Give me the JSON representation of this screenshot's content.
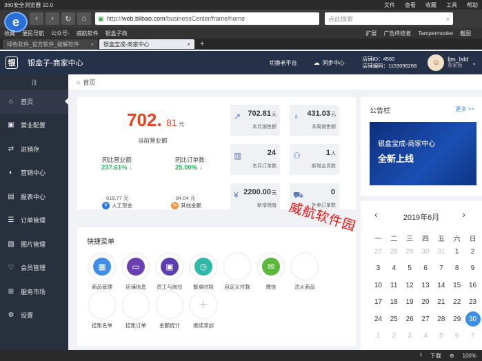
{
  "browser": {
    "title": "360安全浏览器 10.0",
    "menus": [
      "文件",
      "查看",
      "收藏",
      "工具",
      "帮助"
    ],
    "url_prefix": "http://",
    "url_domain": "web.blibao.com",
    "url_path": "/businessCenter/frame/home",
    "search_placeholder": "点此搜索",
    "bookmarks": [
      "收藏",
      "便民导航",
      "公众号-",
      "威航软件",
      "银盒子商"
    ],
    "bookmarks_right": [
      "扩展",
      "广告终结者",
      "Tampermonke",
      "截图"
    ],
    "tabs": [
      {
        "label": "绿色软件_官方软件_破解软件",
        "active": false
      },
      {
        "label": "银盒宝成-商家中心",
        "active": true
      }
    ],
    "status_items": [
      "下载",
      "100%"
    ]
  },
  "header": {
    "logo": "银",
    "brand": "银盒子-商家中心",
    "switch_label": "切换老平台",
    "sync_label": "同步中心",
    "store_id": "店铺ID：4560",
    "store_code": "店铺编码：1153096268",
    "username": "ljm_lsld",
    "role": "渠家面"
  },
  "sidebar": {
    "collapse": "|||",
    "items": [
      {
        "label": "首页",
        "icon": "home-icon",
        "glyph": "⌂"
      },
      {
        "label": "营业配置",
        "icon": "shop-icon",
        "glyph": "▣"
      },
      {
        "label": "进销存",
        "icon": "truck-icon",
        "glyph": "⇄"
      },
      {
        "label": "营销中心",
        "icon": "megaphone-icon",
        "glyph": "◐"
      },
      {
        "label": "报表中心",
        "icon": "report-icon",
        "glyph": "▤"
      },
      {
        "label": "订单管理",
        "icon": "order-icon",
        "glyph": "☰"
      },
      {
        "label": "图片管理",
        "icon": "image-icon",
        "glyph": "▧"
      },
      {
        "label": "会员管理",
        "icon": "member-icon",
        "glyph": "♡"
      },
      {
        "label": "服务市场",
        "icon": "market-icon",
        "glyph": "⊞"
      },
      {
        "label": "设置",
        "icon": "settings-icon",
        "glyph": "⚙"
      }
    ]
  },
  "breadcrumb": "首页",
  "stats": {
    "revenue_int": "702.",
    "revenue_dec": "81",
    "revenue_unit": "元",
    "revenue_label": "当前营业额",
    "yoy_revenue_label": "同比营业额:",
    "yoy_revenue_value": "237.61%",
    "yoy_orders_label": "同比订单数:",
    "yoy_orders_value": "25.00%",
    "cash_value": "618.77 元",
    "cash_label": "人工现金",
    "other_value": "84.04 元",
    "other_label": "其他金额",
    "tiles": [
      {
        "value": "702.81",
        "unit": "元",
        "label": "本月销售额",
        "glyph": "↗"
      },
      {
        "value": "431.03",
        "unit": "元",
        "label": "本周销售额",
        "glyph": "♁"
      },
      {
        "value": "24",
        "unit": "",
        "label": "本月订单数",
        "glyph": "▥"
      },
      {
        "value": "1",
        "unit": "人",
        "label": "新增会员数",
        "glyph": "⚇"
      },
      {
        "value": "2200.00",
        "unit": "元",
        "label": "新增储值",
        "glyph": "¥"
      },
      {
        "value": "0",
        "unit": "",
        "label": "外卖订单数",
        "glyph": "⛟"
      }
    ]
  },
  "quick": {
    "title": "快捷菜单",
    "items": [
      {
        "label": "商品管理",
        "color": "#3f8de8",
        "glyph": "▦"
      },
      {
        "label": "店铺信息",
        "color": "#6a3fb0",
        "glyph": "▭"
      },
      {
        "label": "员工与岗位",
        "color": "#5b3fb0",
        "glyph": "▣"
      },
      {
        "label": "餐桌时段",
        "color": "#2fb8a8",
        "glyph": "◷"
      },
      {
        "label": "自定义付款",
        "color": "",
        "glyph": ""
      },
      {
        "label": "微信",
        "color": "#5cb83a",
        "glyph": "✉"
      },
      {
        "label": "沽火商品",
        "color": "",
        "glyph": ""
      },
      {
        "label": "挂账名单",
        "color": "",
        "glyph": ""
      },
      {
        "label": "挂账订单",
        "color": "",
        "glyph": ""
      },
      {
        "label": "金额统计",
        "color": "",
        "glyph": ""
      },
      {
        "label": "继续添加",
        "color": "",
        "glyph": "+"
      }
    ]
  },
  "announce": {
    "title": "公告栏",
    "more": "更多 >>",
    "banner_line1": "银盒宝成-商家中心",
    "banner_line2": "全新上线"
  },
  "calendar": {
    "title": "2019年6月",
    "weekdays": [
      "一",
      "二",
      "三",
      "四",
      "五",
      "六",
      "日"
    ],
    "days": [
      [
        "27",
        true
      ],
      [
        "28",
        true
      ],
      [
        "29",
        true
      ],
      [
        "30",
        true
      ],
      [
        "31",
        true
      ],
      [
        "1",
        false
      ],
      [
        "2",
        false
      ],
      [
        "3",
        false
      ],
      [
        "4",
        false
      ],
      [
        "5",
        false
      ],
      [
        "6",
        false
      ],
      [
        "7",
        false
      ],
      [
        "8",
        false
      ],
      [
        "9",
        false
      ],
      [
        "10",
        false
      ],
      [
        "11",
        false
      ],
      [
        "12",
        false
      ],
      [
        "13",
        false
      ],
      [
        "14",
        false
      ],
      [
        "15",
        false
      ],
      [
        "16",
        false
      ],
      [
        "17",
        false
      ],
      [
        "18",
        false
      ],
      [
        "19",
        false
      ],
      [
        "20",
        false
      ],
      [
        "21",
        false
      ],
      [
        "22",
        false
      ],
      [
        "23",
        false
      ],
      [
        "24",
        false
      ],
      [
        "25",
        false
      ],
      [
        "26",
        false
      ],
      [
        "27",
        false
      ],
      [
        "28",
        false
      ],
      [
        "29",
        false
      ],
      [
        "30",
        false
      ],
      [
        "1",
        true
      ],
      [
        "2",
        true
      ],
      [
        "3",
        true
      ],
      [
        "4",
        true
      ],
      [
        "5",
        true
      ],
      [
        "6",
        true
      ],
      [
        "7",
        true
      ]
    ],
    "selected_index": 34
  },
  "watermark": "威航软件园"
}
